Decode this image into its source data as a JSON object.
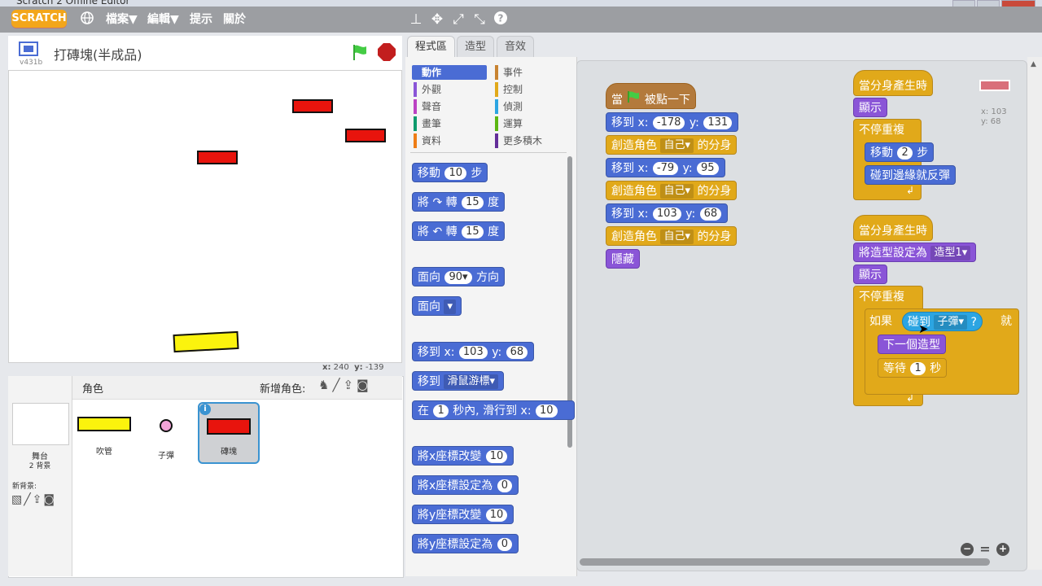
{
  "window": {
    "title": "Scratch 2 Offline Editor"
  },
  "menubar": {
    "logo": "SCRATCH",
    "items": [
      "檔案▼",
      "編輯▼",
      "提示",
      "關於"
    ]
  },
  "stage": {
    "project_title": "打磚塊(半成品)",
    "version": "v431b",
    "mouse_x_label": "x:",
    "mouse_x": "240",
    "mouse_y_label": "y:",
    "mouse_y": "-139"
  },
  "sprites": {
    "header": "角色",
    "new_sprite_label": "新增角色:",
    "stage_label": "舞台",
    "stage_backdrops": "2 背景",
    "new_backdrop_label": "新背景:",
    "items": [
      {
        "name": "吹管",
        "selected": false
      },
      {
        "name": "子彈",
        "selected": false
      },
      {
        "name": "磚塊",
        "selected": true
      }
    ]
  },
  "tabs": [
    "程式區",
    "造型",
    "音效"
  ],
  "categories": [
    {
      "label": "動作",
      "color": "#4a6cd4",
      "active": true
    },
    {
      "label": "事件",
      "color": "#c88330"
    },
    {
      "label": "外觀",
      "color": "#8a55d7"
    },
    {
      "label": "控制",
      "color": "#e1a91a"
    },
    {
      "label": "聲音",
      "color": "#bb42c3"
    },
    {
      "label": "偵測",
      "color": "#2ca5e2"
    },
    {
      "label": "畫筆",
      "color": "#0e9a6c"
    },
    {
      "label": "運算",
      "color": "#5cb712"
    },
    {
      "label": "資料",
      "color": "#ee7d16"
    },
    {
      "label": "更多積木",
      "color": "#632d99"
    }
  ],
  "palette": {
    "move": {
      "pre": "移動",
      "n": "10",
      "post": "步"
    },
    "turn_cw": {
      "pre": "將",
      "icon": "↷",
      "mid": "轉",
      "n": "15",
      "post": "度"
    },
    "turn_ccw": {
      "pre": "將",
      "icon": "↶",
      "mid": "轉",
      "n": "15",
      "post": "度"
    },
    "point_dir": {
      "pre": "面向",
      "n": "90▾",
      "post": "方向"
    },
    "point_towards": {
      "pre": "面向",
      "dd": "▾"
    },
    "goto_xy": {
      "pre": "移到 x:",
      "x": "103",
      "mid": "y:",
      "y": "68"
    },
    "goto_target": {
      "pre": "移到",
      "dd": "滑鼠游標▾"
    },
    "glide": {
      "pre": "在",
      "n": "1",
      "mid": "秒內, 滑行到 x:",
      "x": "10"
    },
    "change_x": {
      "pre": "將x座標改變",
      "n": "10"
    },
    "set_x": {
      "pre": "將x座標設定為",
      "n": "0"
    },
    "change_y": {
      "pre": "將y座標改變",
      "n": "10"
    },
    "set_y": {
      "pre": "將y座標設定為",
      "n": "0"
    }
  },
  "script1": {
    "hat": {
      "pre": "當",
      "post": "被點一下"
    },
    "rows": [
      {
        "type": "goto",
        "x": "-178",
        "y": "131"
      },
      {
        "type": "clone",
        "pre": "創造角色",
        "dd": "自己▾",
        "post": "的分身"
      },
      {
        "type": "goto",
        "x": "-79",
        "y": "95"
      },
      {
        "type": "clone",
        "pre": "創造角色",
        "dd": "自己▾",
        "post": "的分身"
      },
      {
        "type": "goto",
        "x": "103",
        "y": "68"
      },
      {
        "type": "clone",
        "pre": "創造角色",
        "dd": "自己▾",
        "post": "的分身"
      },
      {
        "type": "hide",
        "label": "隱藏"
      }
    ],
    "goto_pre": "移到 x:",
    "goto_mid": "y:"
  },
  "script2": {
    "hat": "當分身產生時",
    "show": "顯示",
    "forever": "不停重複",
    "move": {
      "pre": "移動",
      "n": "2",
      "post": "步"
    },
    "bounce": "碰到邊緣就反彈",
    "arrow": "↲"
  },
  "script3": {
    "hat": "當分身產生時",
    "costume": {
      "pre": "將造型設定為",
      "dd": "造型1▾"
    },
    "show": "顯示",
    "forever": "不停重複",
    "if": {
      "pre": "如果",
      "sense_pre": "碰到",
      "dd": "子彈▾",
      "q": "?",
      "post": "就"
    },
    "next_costume": "下一個造型",
    "wait": {
      "pre": "等待",
      "n": "1",
      "post": "秒"
    },
    "arrow": "↲"
  },
  "sprite_info": {
    "x": "x: 103",
    "y": "y: 68",
    "color": "#d96f7a"
  },
  "zoom": {
    "out": "−",
    "reset": "=",
    "in": "+"
  }
}
